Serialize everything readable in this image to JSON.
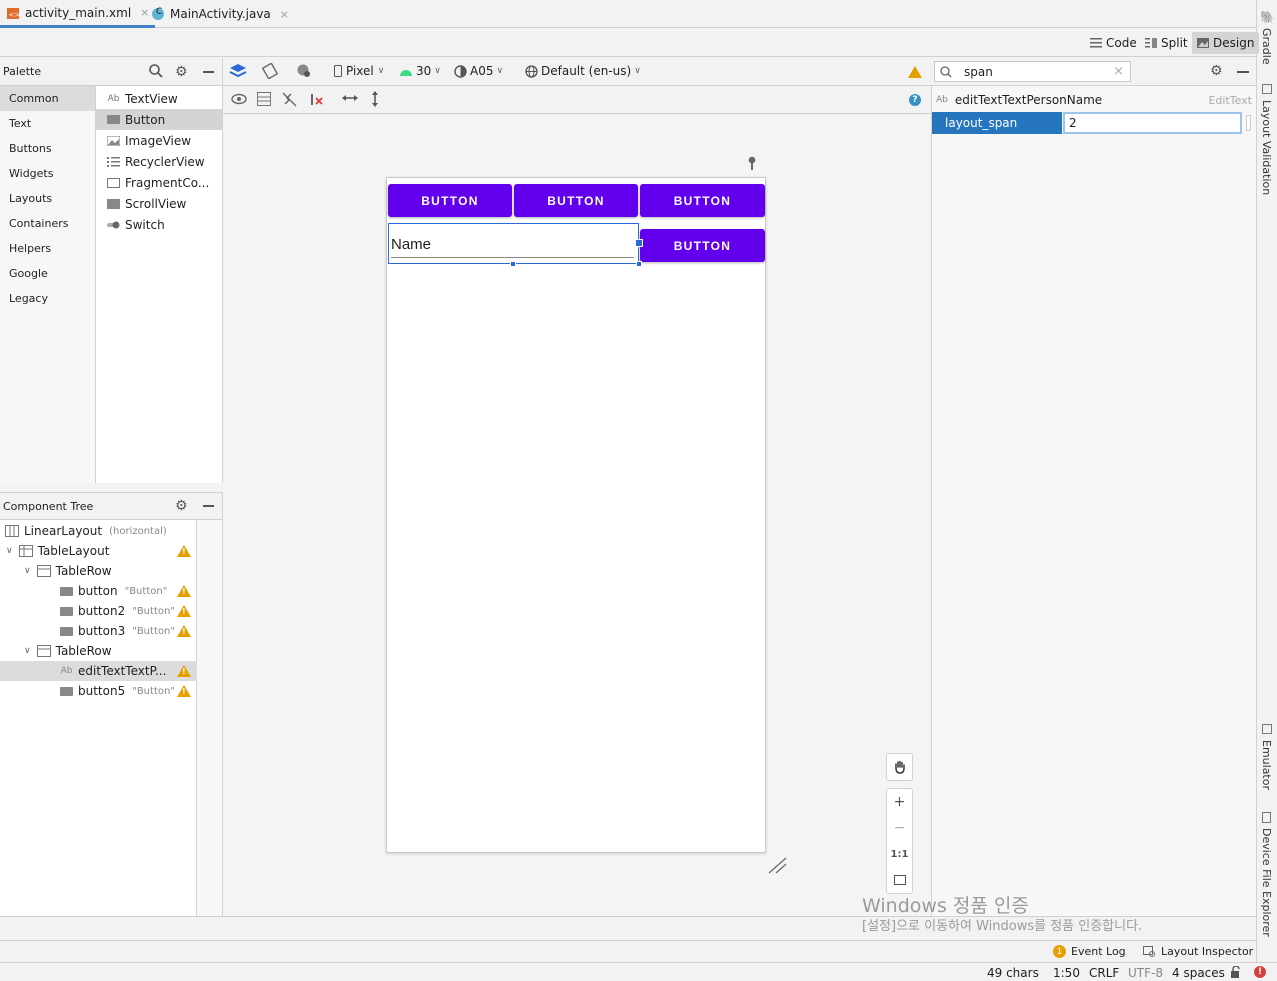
{
  "tabs": [
    {
      "label": "activity_main.xml",
      "icon": "xml-file-icon"
    },
    {
      "label": "MainActivity.java",
      "icon": "java-class-icon"
    }
  ],
  "tab_close": "×",
  "java_badge": "C",
  "right_tools": [
    "Gradle",
    "Layout Validation",
    "Emulator",
    "Device File Explorer"
  ],
  "modes": [
    "Code",
    "Split",
    "Design"
  ],
  "palette": {
    "title": "Palette",
    "categories": [
      "Common",
      "Text",
      "Buttons",
      "Widgets",
      "Layouts",
      "Containers",
      "Helpers",
      "Google",
      "Legacy"
    ],
    "items": [
      "TextView",
      "Button",
      "ImageView",
      "RecyclerView",
      "FragmentCo...",
      "ScrollView",
      "Switch"
    ],
    "textview_icon": "Ab"
  },
  "toolbar": {
    "device": "Pixel",
    "api": "30",
    "theme": "A05",
    "locale": "Default (en-us)"
  },
  "component_tree": {
    "title": "Component Tree",
    "rows": [
      {
        "name": "LinearLayout",
        "hint": "(horizontal)"
      },
      {
        "name": "TableLayout",
        "hint": ""
      },
      {
        "name": "TableRow",
        "hint": ""
      },
      {
        "name": "button",
        "hint": "\"Button\""
      },
      {
        "name": "button2",
        "hint": "\"Button\""
      },
      {
        "name": "button3",
        "hint": "\"Button\""
      },
      {
        "name": "TableRow",
        "hint": ""
      },
      {
        "name": "editTextTextP...",
        "hint": ""
      },
      {
        "name": "button5",
        "hint": "\"Button\""
      }
    ]
  },
  "preview": {
    "buttons": [
      "BUTTON",
      "BUTTON",
      "BUTTON",
      "BUTTON"
    ],
    "edit_text": "Name"
  },
  "zoom": {
    "fit_label": "1:1"
  },
  "attributes": {
    "search": "span",
    "component": "editTextTextPersonName",
    "component_type": "EditText",
    "attr_icon": "Ab",
    "attr_name": "layout_span",
    "attr_value": "2"
  },
  "watermark": {
    "line1": "Windows 정품 인증",
    "line2": "[설정]으로 이동하여 Windows를 정품 인증합니다."
  },
  "tool_windows": {
    "event_log": "Event Log",
    "event_badge": "1",
    "layout_inspector": "Layout Inspector"
  },
  "status": {
    "chars": "49 chars",
    "position": "1:50",
    "line_sep": "CRLF",
    "encoding": "UTF-8",
    "indent": "4 spaces"
  },
  "colors": {
    "primary": "#6200ee",
    "selection": "#2a6ad6",
    "warning": "#e5a000"
  }
}
